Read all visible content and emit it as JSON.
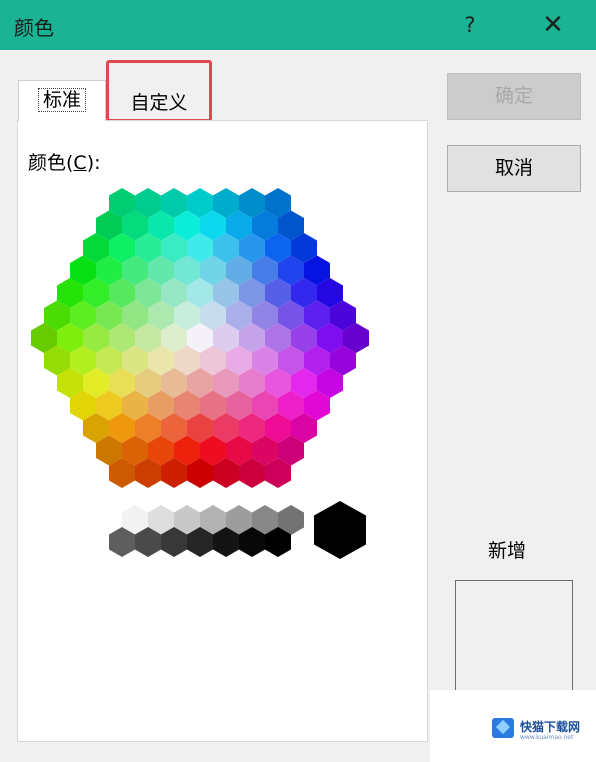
{
  "window": {
    "title": "颜色",
    "help": "?",
    "close": "✕"
  },
  "tabs": [
    {
      "label": "标准",
      "selected": true
    },
    {
      "label": "自定义",
      "highlighted": true
    }
  ],
  "color_label": {
    "text": "颜色(",
    "hotkey": "C",
    "suffix": "):"
  },
  "buttons": {
    "ok": "确定",
    "cancel": "取消"
  },
  "new_color": {
    "label": "新增",
    "swatch_color": "#f0f0f0"
  },
  "watermark": {
    "text": "快猫下载网",
    "url": "www.kuaimao.net"
  },
  "colors": {
    "titlebar": "#1ab394",
    "tab_highlight": "#e04851",
    "selected_black": "#000000"
  }
}
